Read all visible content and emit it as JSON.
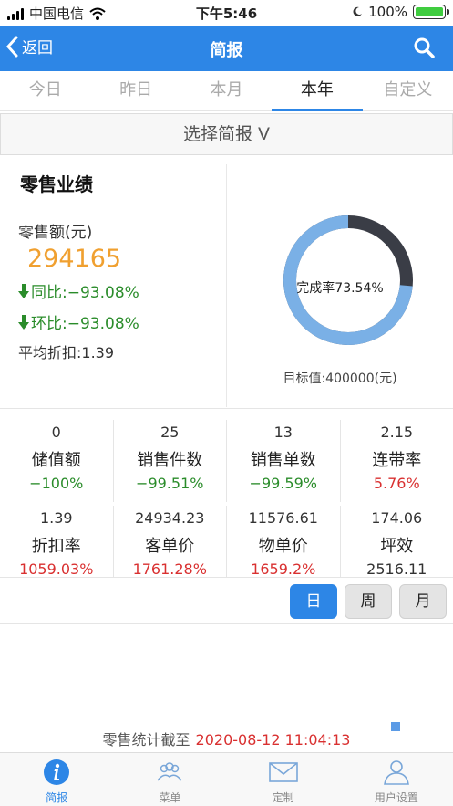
{
  "status_bar": {
    "carrier": "中国电信",
    "time": "下午5:46",
    "battery": "100%"
  },
  "navbar": {
    "back_label": "返回",
    "title": "简报"
  },
  "tabs": [
    {
      "label": "今日"
    },
    {
      "label": "昨日"
    },
    {
      "label": "本月"
    },
    {
      "label": "本年"
    },
    {
      "label": "自定义"
    }
  ],
  "active_tab": "本年",
  "selector": {
    "label": "选择简报 V"
  },
  "sales": {
    "heading": "零售业绩",
    "amount_label": "零售额(元)",
    "amount": "294165",
    "yoy": "同比:−93.08%",
    "mom": "环比:−93.08%",
    "avg_discount": "平均折扣:1.39"
  },
  "completion": {
    "label": "完成率73.54%",
    "rate": 73.54,
    "target": "目标值:400000(元)"
  },
  "metrics_row1": [
    {
      "value": "0",
      "name": "储值额",
      "change": "−100%",
      "tone": "green"
    },
    {
      "value": "25",
      "name": "销售件数",
      "change": "−99.51%",
      "tone": "green"
    },
    {
      "value": "13",
      "name": "销售单数",
      "change": "−99.59%",
      "tone": "green"
    },
    {
      "value": "2.15",
      "name": "连带率",
      "change": "5.76%",
      "tone": "red"
    }
  ],
  "metrics_row2": [
    {
      "value": "1.39",
      "name": "折扣率",
      "change": "1059.03%",
      "tone": "red"
    },
    {
      "value": "24934.23",
      "name": "客单价",
      "change": "1761.28%",
      "tone": "red"
    },
    {
      "value": "11576.61",
      "name": "物单价",
      "change": "1659.2%",
      "tone": "red"
    },
    {
      "value": "174.06",
      "name": "坪效",
      "change": "2516.11",
      "tone": "gray"
    }
  ],
  "period_buttons": {
    "day": "日",
    "week": "周",
    "month": "月"
  },
  "footer": {
    "stat_label": "零售统计截至",
    "timestamp": "2020-08-12 11:04:13"
  },
  "bottom_nav": [
    {
      "label": "简报",
      "icon": "info-icon"
    },
    {
      "label": "菜单",
      "icon": "people-icon"
    },
    {
      "label": "定制",
      "icon": "envelope-icon"
    },
    {
      "label": "用户设置",
      "icon": "user-icon"
    }
  ],
  "colors": {
    "primary": "#2d86e6",
    "amount": "#f0a030",
    "down": "#2a8c2a",
    "up": "#d93030",
    "ring": "#7ab0e6",
    "ring_remaining": "#3a3d46"
  }
}
